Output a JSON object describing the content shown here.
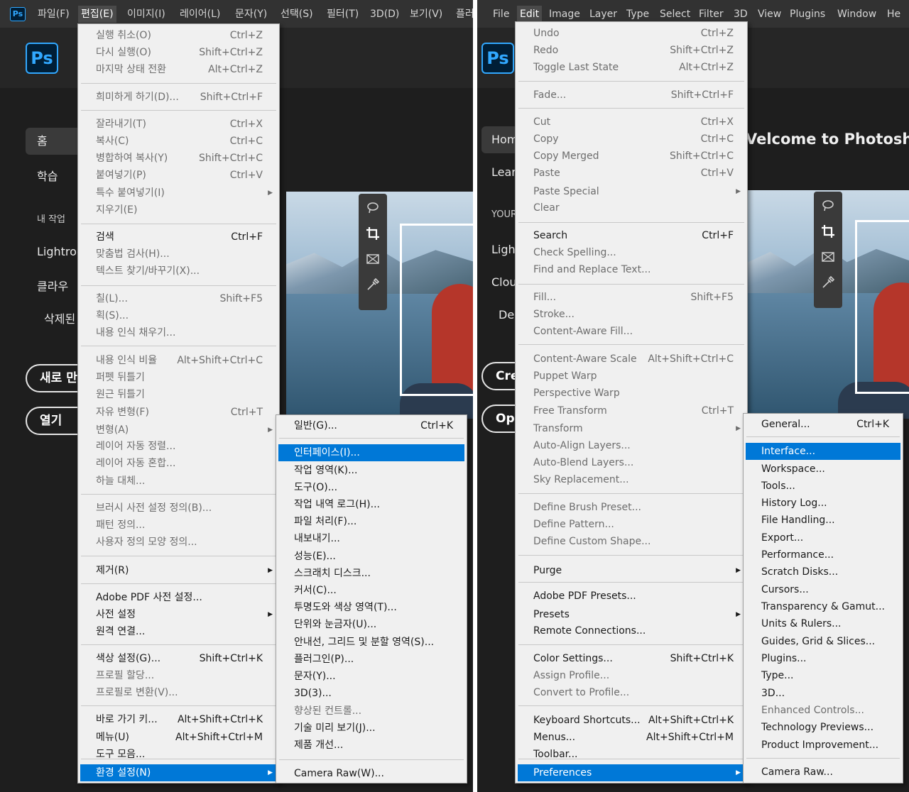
{
  "korean": {
    "menubar": [
      "파일(F)",
      "편집(E)",
      "이미지(I)",
      "레이어(L)",
      "문자(Y)",
      "선택(S)",
      "필터(T)",
      "3D(D)",
      "보기(V)",
      "플러"
    ],
    "logo_small": "Ps",
    "logo": "Ps",
    "nav": [
      "홈",
      "학습",
      "내 작업",
      "Lightroo",
      "클라우",
      "삭제된"
    ],
    "buttons": [
      "새로 만",
      "열기"
    ],
    "edit_menu": [
      {
        "label": "실행 취소(O)",
        "shortcut": "Ctrl+Z"
      },
      {
        "label": "다시 실행(O)",
        "shortcut": "Shift+Ctrl+Z"
      },
      {
        "label": "마지막 상태 전환",
        "shortcut": "Alt+Ctrl+Z"
      },
      {
        "label": "희미하게 하기(D)...",
        "shortcut": "Shift+Ctrl+F"
      },
      {
        "label": "잘라내기(T)",
        "shortcut": "Ctrl+X"
      },
      {
        "label": "복사(C)",
        "shortcut": "Ctrl+C"
      },
      {
        "label": "병합하여 복사(Y)",
        "shortcut": "Shift+Ctrl+C"
      },
      {
        "label": "붙여넣기(P)",
        "shortcut": "Ctrl+V"
      },
      {
        "label": "특수 붙여넣기(I)",
        "shortcut": ""
      },
      {
        "label": "지우기(E)",
        "shortcut": ""
      },
      {
        "label": "검색",
        "shortcut": "Ctrl+F"
      },
      {
        "label": "맞춤법 검사(H)...",
        "shortcut": ""
      },
      {
        "label": "텍스트 찾기/바꾸기(X)...",
        "shortcut": ""
      },
      {
        "label": "칠(L)...",
        "shortcut": "Shift+F5"
      },
      {
        "label": "획(S)...",
        "shortcut": ""
      },
      {
        "label": "내용 인식 채우기...",
        "shortcut": ""
      },
      {
        "label": "내용 인식 비율",
        "shortcut": "Alt+Shift+Ctrl+C"
      },
      {
        "label": "퍼펫 뒤틀기",
        "shortcut": ""
      },
      {
        "label": "원근 뒤틀기",
        "shortcut": ""
      },
      {
        "label": "자유 변형(F)",
        "shortcut": "Ctrl+T"
      },
      {
        "label": "변형(A)",
        "shortcut": ""
      },
      {
        "label": "레이어 자동 정렬...",
        "shortcut": ""
      },
      {
        "label": "레이어 자동 혼합...",
        "shortcut": ""
      },
      {
        "label": "하늘 대체...",
        "shortcut": ""
      },
      {
        "label": "브러시 사전 설정 정의(B)...",
        "shortcut": ""
      },
      {
        "label": "패턴 정의...",
        "shortcut": ""
      },
      {
        "label": "사용자 정의 모양 정의...",
        "shortcut": ""
      },
      {
        "label": "제거(R)",
        "shortcut": ""
      },
      {
        "label": "Adobe PDF 사전 설정...",
        "shortcut": ""
      },
      {
        "label": "사전 설정",
        "shortcut": ""
      },
      {
        "label": "원격 연결...",
        "shortcut": ""
      },
      {
        "label": "색상 설정(G)...",
        "shortcut": "Shift+Ctrl+K"
      },
      {
        "label": "프로필 할당...",
        "shortcut": ""
      },
      {
        "label": "프로필로 변환(V)...",
        "shortcut": ""
      },
      {
        "label": "바로 가기 키...",
        "shortcut": "Alt+Shift+Ctrl+K"
      },
      {
        "label": "메뉴(U)",
        "shortcut": "Alt+Shift+Ctrl+M"
      },
      {
        "label": "도구 모음...",
        "shortcut": ""
      },
      {
        "label": "환경 설정(N)",
        "shortcut": ""
      }
    ],
    "prefs_menu": [
      {
        "label": "일반(G)...",
        "shortcut": "Ctrl+K"
      },
      {
        "label": "인터페이스(I)...",
        "shortcut": ""
      },
      {
        "label": "작업 영역(K)...",
        "shortcut": ""
      },
      {
        "label": "도구(O)...",
        "shortcut": ""
      },
      {
        "label": "작업 내역 로그(H)...",
        "shortcut": ""
      },
      {
        "label": "파일 처리(F)...",
        "shortcut": ""
      },
      {
        "label": "내보내기...",
        "shortcut": ""
      },
      {
        "label": "성능(E)...",
        "shortcut": ""
      },
      {
        "label": "스크래치 디스크...",
        "shortcut": ""
      },
      {
        "label": "커서(C)...",
        "shortcut": ""
      },
      {
        "label": "투명도와 색상 영역(T)...",
        "shortcut": ""
      },
      {
        "label": "단위와 눈금자(U)...",
        "shortcut": ""
      },
      {
        "label": "안내선, 그리드 및 분할 영역(S)...",
        "shortcut": ""
      },
      {
        "label": "플러그인(P)...",
        "shortcut": ""
      },
      {
        "label": "문자(Y)...",
        "shortcut": ""
      },
      {
        "label": "3D(3)...",
        "shortcut": ""
      },
      {
        "label": "향상된 컨트롤...",
        "shortcut": ""
      },
      {
        "label": "기술 미리 보기(J)...",
        "shortcut": ""
      },
      {
        "label": "제품 개선...",
        "shortcut": ""
      },
      {
        "label": "Camera Raw(W)...",
        "shortcut": ""
      }
    ]
  },
  "english": {
    "menubar": [
      "File",
      "Edit",
      "Image",
      "Layer",
      "Type",
      "Select",
      "Filter",
      "3D",
      "View",
      "Plugins",
      "Window",
      "He"
    ],
    "logo": "Ps",
    "welcome": "Velcome to Photoshop",
    "nav": [
      "Hom",
      "Lear",
      "YOUR",
      "Ligh",
      "Clou",
      "Del"
    ],
    "buttons": [
      "Crea",
      "Op"
    ],
    "edit_menu": [
      {
        "label": "Undo",
        "shortcut": "Ctrl+Z"
      },
      {
        "label": "Redo",
        "shortcut": "Shift+Ctrl+Z"
      },
      {
        "label": "Toggle Last State",
        "shortcut": "Alt+Ctrl+Z"
      },
      {
        "label": "Fade...",
        "shortcut": "Shift+Ctrl+F"
      },
      {
        "label": "Cut",
        "shortcut": "Ctrl+X"
      },
      {
        "label": "Copy",
        "shortcut": "Ctrl+C"
      },
      {
        "label": "Copy Merged",
        "shortcut": "Shift+Ctrl+C"
      },
      {
        "label": "Paste",
        "shortcut": "Ctrl+V"
      },
      {
        "label": "Paste Special",
        "shortcut": ""
      },
      {
        "label": "Clear",
        "shortcut": ""
      },
      {
        "label": "Search",
        "shortcut": "Ctrl+F"
      },
      {
        "label": "Check Spelling...",
        "shortcut": ""
      },
      {
        "label": "Find and Replace Text...",
        "shortcut": ""
      },
      {
        "label": "Fill...",
        "shortcut": "Shift+F5"
      },
      {
        "label": "Stroke...",
        "shortcut": ""
      },
      {
        "label": "Content-Aware Fill...",
        "shortcut": ""
      },
      {
        "label": "Content-Aware Scale",
        "shortcut": "Alt+Shift+Ctrl+C"
      },
      {
        "label": "Puppet Warp",
        "shortcut": ""
      },
      {
        "label": "Perspective Warp",
        "shortcut": ""
      },
      {
        "label": "Free Transform",
        "shortcut": "Ctrl+T"
      },
      {
        "label": "Transform",
        "shortcut": ""
      },
      {
        "label": "Auto-Align Layers...",
        "shortcut": ""
      },
      {
        "label": "Auto-Blend Layers...",
        "shortcut": ""
      },
      {
        "label": "Sky Replacement...",
        "shortcut": ""
      },
      {
        "label": "Define Brush Preset...",
        "shortcut": ""
      },
      {
        "label": "Define Pattern...",
        "shortcut": ""
      },
      {
        "label": "Define Custom Shape...",
        "shortcut": ""
      },
      {
        "label": "Purge",
        "shortcut": ""
      },
      {
        "label": "Adobe PDF Presets...",
        "shortcut": ""
      },
      {
        "label": "Presets",
        "shortcut": ""
      },
      {
        "label": "Remote Connections...",
        "shortcut": ""
      },
      {
        "label": "Color Settings...",
        "shortcut": "Shift+Ctrl+K"
      },
      {
        "label": "Assign Profile...",
        "shortcut": ""
      },
      {
        "label": "Convert to Profile...",
        "shortcut": ""
      },
      {
        "label": "Keyboard Shortcuts...",
        "shortcut": "Alt+Shift+Ctrl+K"
      },
      {
        "label": "Menus...",
        "shortcut": "Alt+Shift+Ctrl+M"
      },
      {
        "label": "Toolbar...",
        "shortcut": ""
      },
      {
        "label": "Preferences",
        "shortcut": ""
      }
    ],
    "prefs_menu": [
      {
        "label": "General...",
        "shortcut": "Ctrl+K"
      },
      {
        "label": "Interface...",
        "shortcut": ""
      },
      {
        "label": "Workspace...",
        "shortcut": ""
      },
      {
        "label": "Tools...",
        "shortcut": ""
      },
      {
        "label": "History Log...",
        "shortcut": ""
      },
      {
        "label": "File Handling...",
        "shortcut": ""
      },
      {
        "label": "Export...",
        "shortcut": ""
      },
      {
        "label": "Performance...",
        "shortcut": ""
      },
      {
        "label": "Scratch Disks...",
        "shortcut": ""
      },
      {
        "label": "Cursors...",
        "shortcut": ""
      },
      {
        "label": "Transparency & Gamut...",
        "shortcut": ""
      },
      {
        "label": "Units & Rulers...",
        "shortcut": ""
      },
      {
        "label": "Guides, Grid & Slices...",
        "shortcut": ""
      },
      {
        "label": "Plugins...",
        "shortcut": ""
      },
      {
        "label": "Type...",
        "shortcut": ""
      },
      {
        "label": "3D...",
        "shortcut": ""
      },
      {
        "label": "Enhanced Controls...",
        "shortcut": ""
      },
      {
        "label": "Technology Previews...",
        "shortcut": ""
      },
      {
        "label": "Product Improvement...",
        "shortcut": ""
      },
      {
        "label": "Camera Raw...",
        "shortcut": ""
      }
    ]
  },
  "icons": [
    "lasso-icon",
    "crop-icon",
    "frame-icon",
    "eyedropper-icon",
    "submenu-arrow-icon"
  ],
  "colors": {
    "menu_bg": "#f0f0f0",
    "highlight": "#0078d7",
    "app_bg": "#1e1e1e",
    "menubar_bg": "#323232",
    "ps_blue": "#31a8ff",
    "ps_dark": "#001e36"
  }
}
